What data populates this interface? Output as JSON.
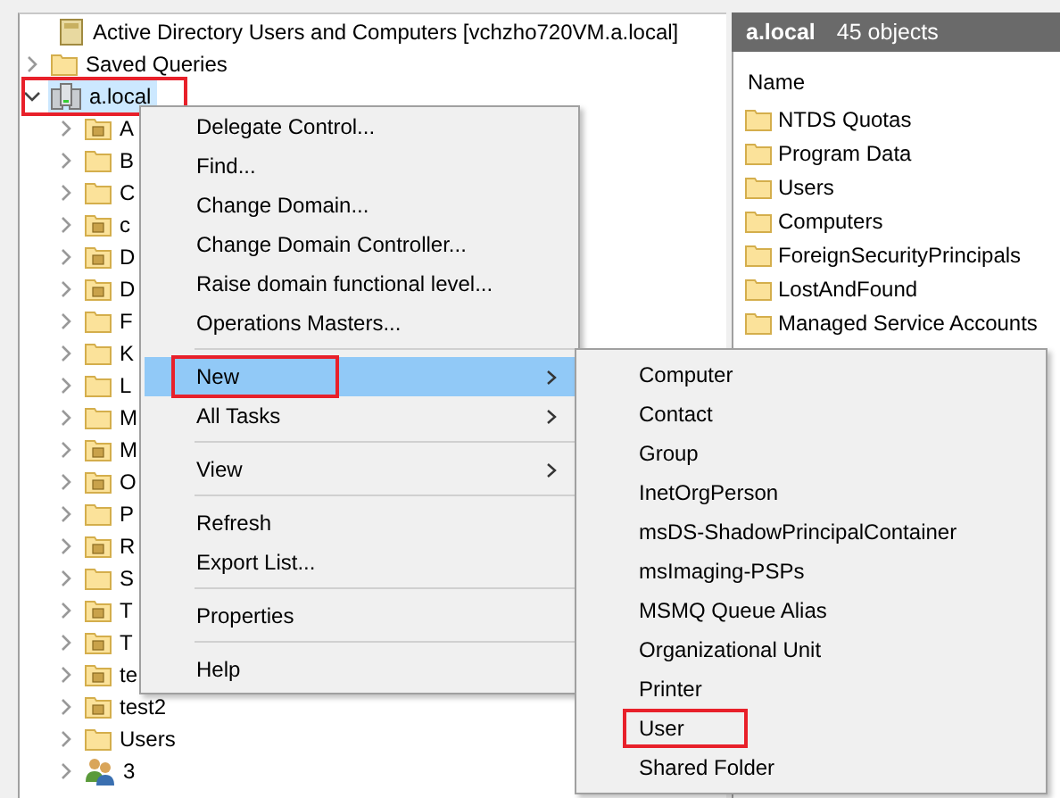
{
  "tree": [
    {
      "label": "Active Directory Users and Computers [vchzho720VM.a.local]",
      "kind": "root",
      "children": [
        {
          "label": "Saved Queries",
          "kind": "folder",
          "expanded": false,
          "selected": false
        },
        {
          "label": "a.local",
          "kind": "domain",
          "expanded": true,
          "selected": true,
          "annotated": true,
          "children": [
            {
              "label": "A",
              "kind": "ou",
              "expanded": false,
              "selected": false
            },
            {
              "label": "B",
              "kind": "folder",
              "expanded": false,
              "selected": false
            },
            {
              "label": "C",
              "kind": "folder",
              "expanded": false,
              "selected": false
            },
            {
              "label": "c",
              "kind": "ou",
              "expanded": false,
              "selected": false
            },
            {
              "label": "D",
              "kind": "ou",
              "expanded": false,
              "selected": false
            },
            {
              "label": "D",
              "kind": "ou",
              "expanded": false,
              "selected": false
            },
            {
              "label": "F",
              "kind": "folder",
              "expanded": false,
              "selected": false
            },
            {
              "label": "K",
              "kind": "folder",
              "expanded": false,
              "selected": false
            },
            {
              "label": "L",
              "kind": "folder",
              "expanded": false,
              "selected": false
            },
            {
              "label": "M",
              "kind": "folder",
              "expanded": false,
              "selected": false
            },
            {
              "label": "M",
              "kind": "ou",
              "expanded": false,
              "selected": false
            },
            {
              "label": "O",
              "kind": "ou",
              "expanded": false,
              "selected": false
            },
            {
              "label": "P",
              "kind": "folder",
              "expanded": false,
              "selected": false
            },
            {
              "label": "R",
              "kind": "ou",
              "expanded": false,
              "selected": false
            },
            {
              "label": "S",
              "kind": "folder",
              "expanded": false,
              "selected": false
            },
            {
              "label": "T",
              "kind": "ou",
              "expanded": false,
              "selected": false
            },
            {
              "label": "T",
              "kind": "ou",
              "expanded": false,
              "selected": false
            },
            {
              "label": "te",
              "kind": "ou",
              "expanded": false,
              "selected": false
            },
            {
              "label": "test2",
              "kind": "ou",
              "expanded": false,
              "selected": false
            },
            {
              "label": "Users",
              "kind": "folder",
              "expanded": false,
              "selected": false
            },
            {
              "label": "3",
              "kind": "group",
              "expanded": false,
              "selected": false
            }
          ]
        }
      ]
    }
  ],
  "details": {
    "title": "a.local",
    "count": "45 objects",
    "columns": [
      "Name"
    ],
    "rows": [
      {
        "name": "NTDS Quotas"
      },
      {
        "name": "Program Data"
      },
      {
        "name": "Users"
      },
      {
        "name": "Computers"
      },
      {
        "name": "ForeignSecurityPrincipals"
      },
      {
        "name": "LostAndFound"
      },
      {
        "name": "Managed Service Accounts"
      }
    ]
  },
  "context_menu": {
    "items": [
      {
        "kind": "item",
        "label": "Delegate Control...",
        "selected": false,
        "submenu": false,
        "annotated": false
      },
      {
        "kind": "item",
        "label": "Find...",
        "selected": false,
        "submenu": false,
        "annotated": false
      },
      {
        "kind": "item",
        "label": "Change Domain...",
        "selected": false,
        "submenu": false,
        "annotated": false
      },
      {
        "kind": "item",
        "label": "Change Domain Controller...",
        "selected": false,
        "submenu": false,
        "annotated": false
      },
      {
        "kind": "item",
        "label": "Raise domain functional level...",
        "selected": false,
        "submenu": false,
        "annotated": false
      },
      {
        "kind": "item",
        "label": "Operations Masters...",
        "selected": false,
        "submenu": false,
        "annotated": false
      },
      {
        "kind": "separator"
      },
      {
        "kind": "item",
        "label": "New",
        "selected": true,
        "submenu": true,
        "annotated": true
      },
      {
        "kind": "item",
        "label": "All Tasks",
        "selected": false,
        "submenu": true,
        "annotated": false
      },
      {
        "kind": "separator"
      },
      {
        "kind": "item",
        "label": "View",
        "selected": false,
        "submenu": true,
        "annotated": false
      },
      {
        "kind": "separator"
      },
      {
        "kind": "item",
        "label": "Refresh",
        "selected": false,
        "submenu": false,
        "annotated": false
      },
      {
        "kind": "item",
        "label": "Export List...",
        "selected": false,
        "submenu": false,
        "annotated": false
      },
      {
        "kind": "separator"
      },
      {
        "kind": "item",
        "label": "Properties",
        "selected": false,
        "submenu": false,
        "annotated": false
      },
      {
        "kind": "separator"
      },
      {
        "kind": "item",
        "label": "Help",
        "selected": false,
        "submenu": false,
        "annotated": false
      }
    ]
  },
  "submenu": {
    "items": [
      {
        "label": "Computer",
        "annotated": false
      },
      {
        "label": "Contact",
        "annotated": false
      },
      {
        "label": "Group",
        "annotated": false
      },
      {
        "label": "InetOrgPerson",
        "annotated": false
      },
      {
        "label": "msDS-ShadowPrincipalContainer",
        "annotated": false
      },
      {
        "label": "msImaging-PSPs",
        "annotated": false
      },
      {
        "label": "MSMQ Queue Alias",
        "annotated": false
      },
      {
        "label": "Organizational Unit",
        "annotated": false
      },
      {
        "label": "Printer",
        "annotated": false
      },
      {
        "label": "User",
        "annotated": true
      },
      {
        "label": "Shared Folder",
        "annotated": false
      }
    ]
  }
}
